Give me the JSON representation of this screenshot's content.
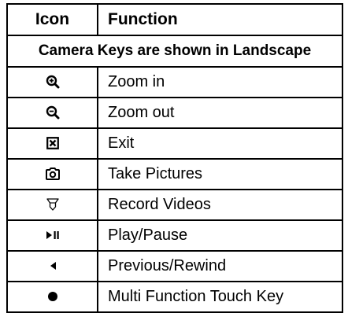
{
  "table": {
    "headers": {
      "icon": "Icon",
      "function": "Function"
    },
    "section_title": "Camera Keys are shown in Landscape",
    "rows": [
      {
        "icon": "zoom-in-icon",
        "function": "Zoom in"
      },
      {
        "icon": "zoom-out-icon",
        "function": "Zoom out"
      },
      {
        "icon": "exit-icon",
        "function": "Exit"
      },
      {
        "icon": "camera-icon",
        "function": "Take Pictures"
      },
      {
        "icon": "video-camera-icon",
        "function": "Record Videos"
      },
      {
        "icon": "play-pause-icon",
        "function": "Play/Pause"
      },
      {
        "icon": "rewind-icon",
        "function": "Previous/Rewind"
      },
      {
        "icon": "dot-icon",
        "function": "Multi Function Touch Key"
      }
    ]
  }
}
